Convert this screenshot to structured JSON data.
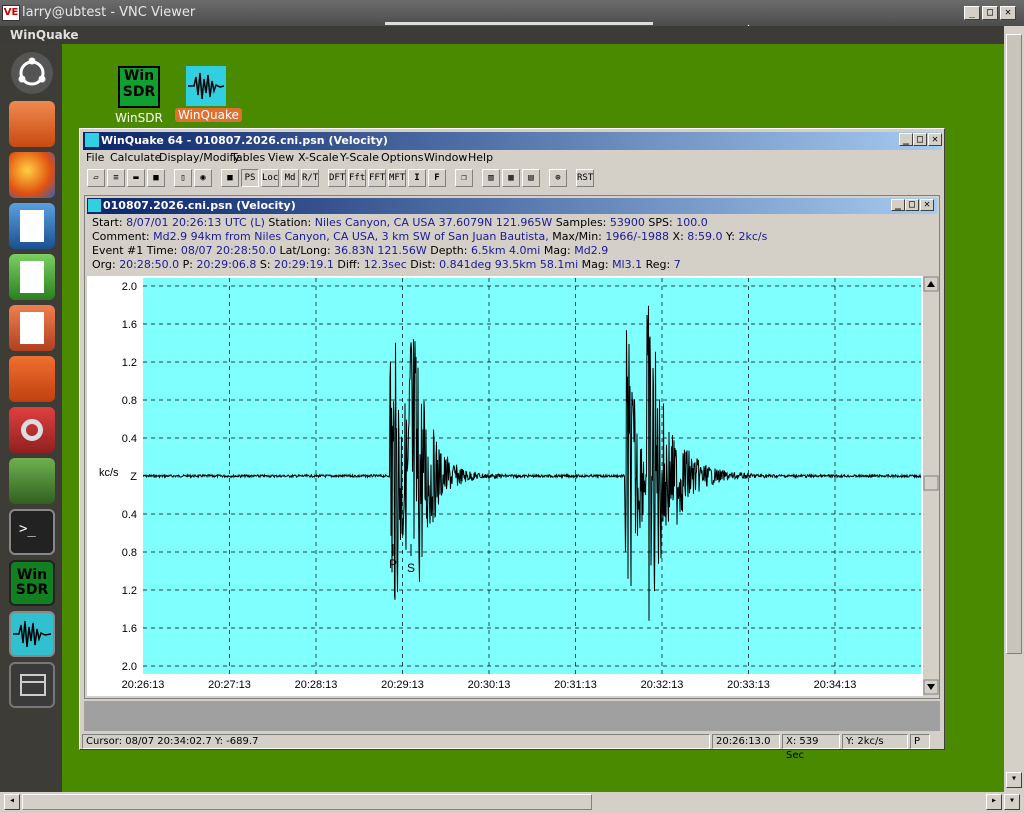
{
  "vnc": {
    "title": "larry@ubtest - VNC Viewer",
    "logo": "VE"
  },
  "ubuntu": {
    "topbar_title": "WinQuake"
  },
  "desktop_icons": [
    {
      "label": "WinSDR",
      "glyph": "Win\nSDR"
    },
    {
      "label": "WinQuake"
    }
  ],
  "winquake": {
    "title": "WinQuake 64 - 010807.2026.cni.psn (Velocity)",
    "menu": [
      "File",
      "Calculate",
      "Display/Modify",
      "Tables",
      "View",
      "X-Scale",
      "Y-Scale",
      "Options",
      "Window",
      "Help"
    ],
    "toolbar": [
      "open",
      "list",
      "save-all",
      "save",
      "doc",
      "circle",
      "save2",
      "PS",
      "LOC",
      "Md",
      "R/T",
      "DFT",
      "Fft",
      "FFT",
      "MFT",
      "I",
      "F",
      "copy",
      "grid1",
      "grid2",
      "grid3",
      "target",
      "RST"
    ],
    "toolbar_labels": {
      "PS": "PS",
      "LOC": "Loc",
      "Md": "Md",
      "RT": "R/T",
      "DFT": "DFT",
      "Fft": "Fft",
      "FFT": "FFT",
      "MFT": "MFT",
      "I": "I",
      "F": "F",
      "RST": "RST"
    }
  },
  "child": {
    "title": "010807.2026.cni.psn (Velocity)",
    "line1": {
      "p1": "Start: ",
      "v1": "8/07/01 20:26:13 UTC (L)",
      "p2": " Station: ",
      "v2": "Niles Canyon, CA USA 37.6079N 121.965W",
      "p3": " Samples: ",
      "v3": "53900",
      "p4": "  SPS: ",
      "v4": "100.0"
    },
    "line2": {
      "p1": "Comment: ",
      "v1": "Md2.9 94km from Niles Canyon, CA USA, 3 km SW of San Juan Bautista,",
      "p2": "  Max/Min: ",
      "v2": "1966/-1988",
      "p3": " X: ",
      "v3": "8:59.0",
      "p4": " Y: ",
      "v4": "2kc/s"
    },
    "line3": {
      "p1": "Event #1 Time: ",
      "v1": "08/07 20:28:50.0",
      "p2": " Lat/Long: ",
      "v2": "36.83N 121.56W",
      "p3": " Depth: ",
      "v3": "6.5km 4.0mi",
      "p4": " Mag: ",
      "v4": "Md2.9"
    },
    "line4": {
      "p1": "Org: ",
      "v1": "20:28:50.0",
      "p2": " P: ",
      "v2": "20:29:06.8",
      "p3": " S: ",
      "v3": "20:29:19.1",
      "p4": " Diff: ",
      "v4": "12.3sec",
      "p5": " Dist: ",
      "v5": "0.841deg 93.5km 58.1mi",
      "p6": "  Mag: ",
      "v6": "Ml3.1",
      "p7": " Reg: ",
      "v7": "7"
    }
  },
  "plot": {
    "y_ticks": [
      "2.0",
      "1.6",
      "1.2",
      "0.8",
      "0.4",
      "Z",
      "0.4",
      "0.8",
      "1.2",
      "1.6",
      "2.0"
    ],
    "y_unit": "kc/s",
    "x_ticks": [
      "20:26:13",
      "20:27:13",
      "20:28:13",
      "20:29:13",
      "20:30:13",
      "20:31:13",
      "20:32:13",
      "20:33:13",
      "20:34:13"
    ],
    "p_label": "P",
    "s_label": "S",
    "bg_color": "#80ffff"
  },
  "status": {
    "cursor": "Cursor: 08/07 20:34:02.7  Y: -689.7",
    "time": "20:26:13.0",
    "x": "X: 539 Sec",
    "y": "Y: 2kc/s",
    "mode": "P"
  }
}
